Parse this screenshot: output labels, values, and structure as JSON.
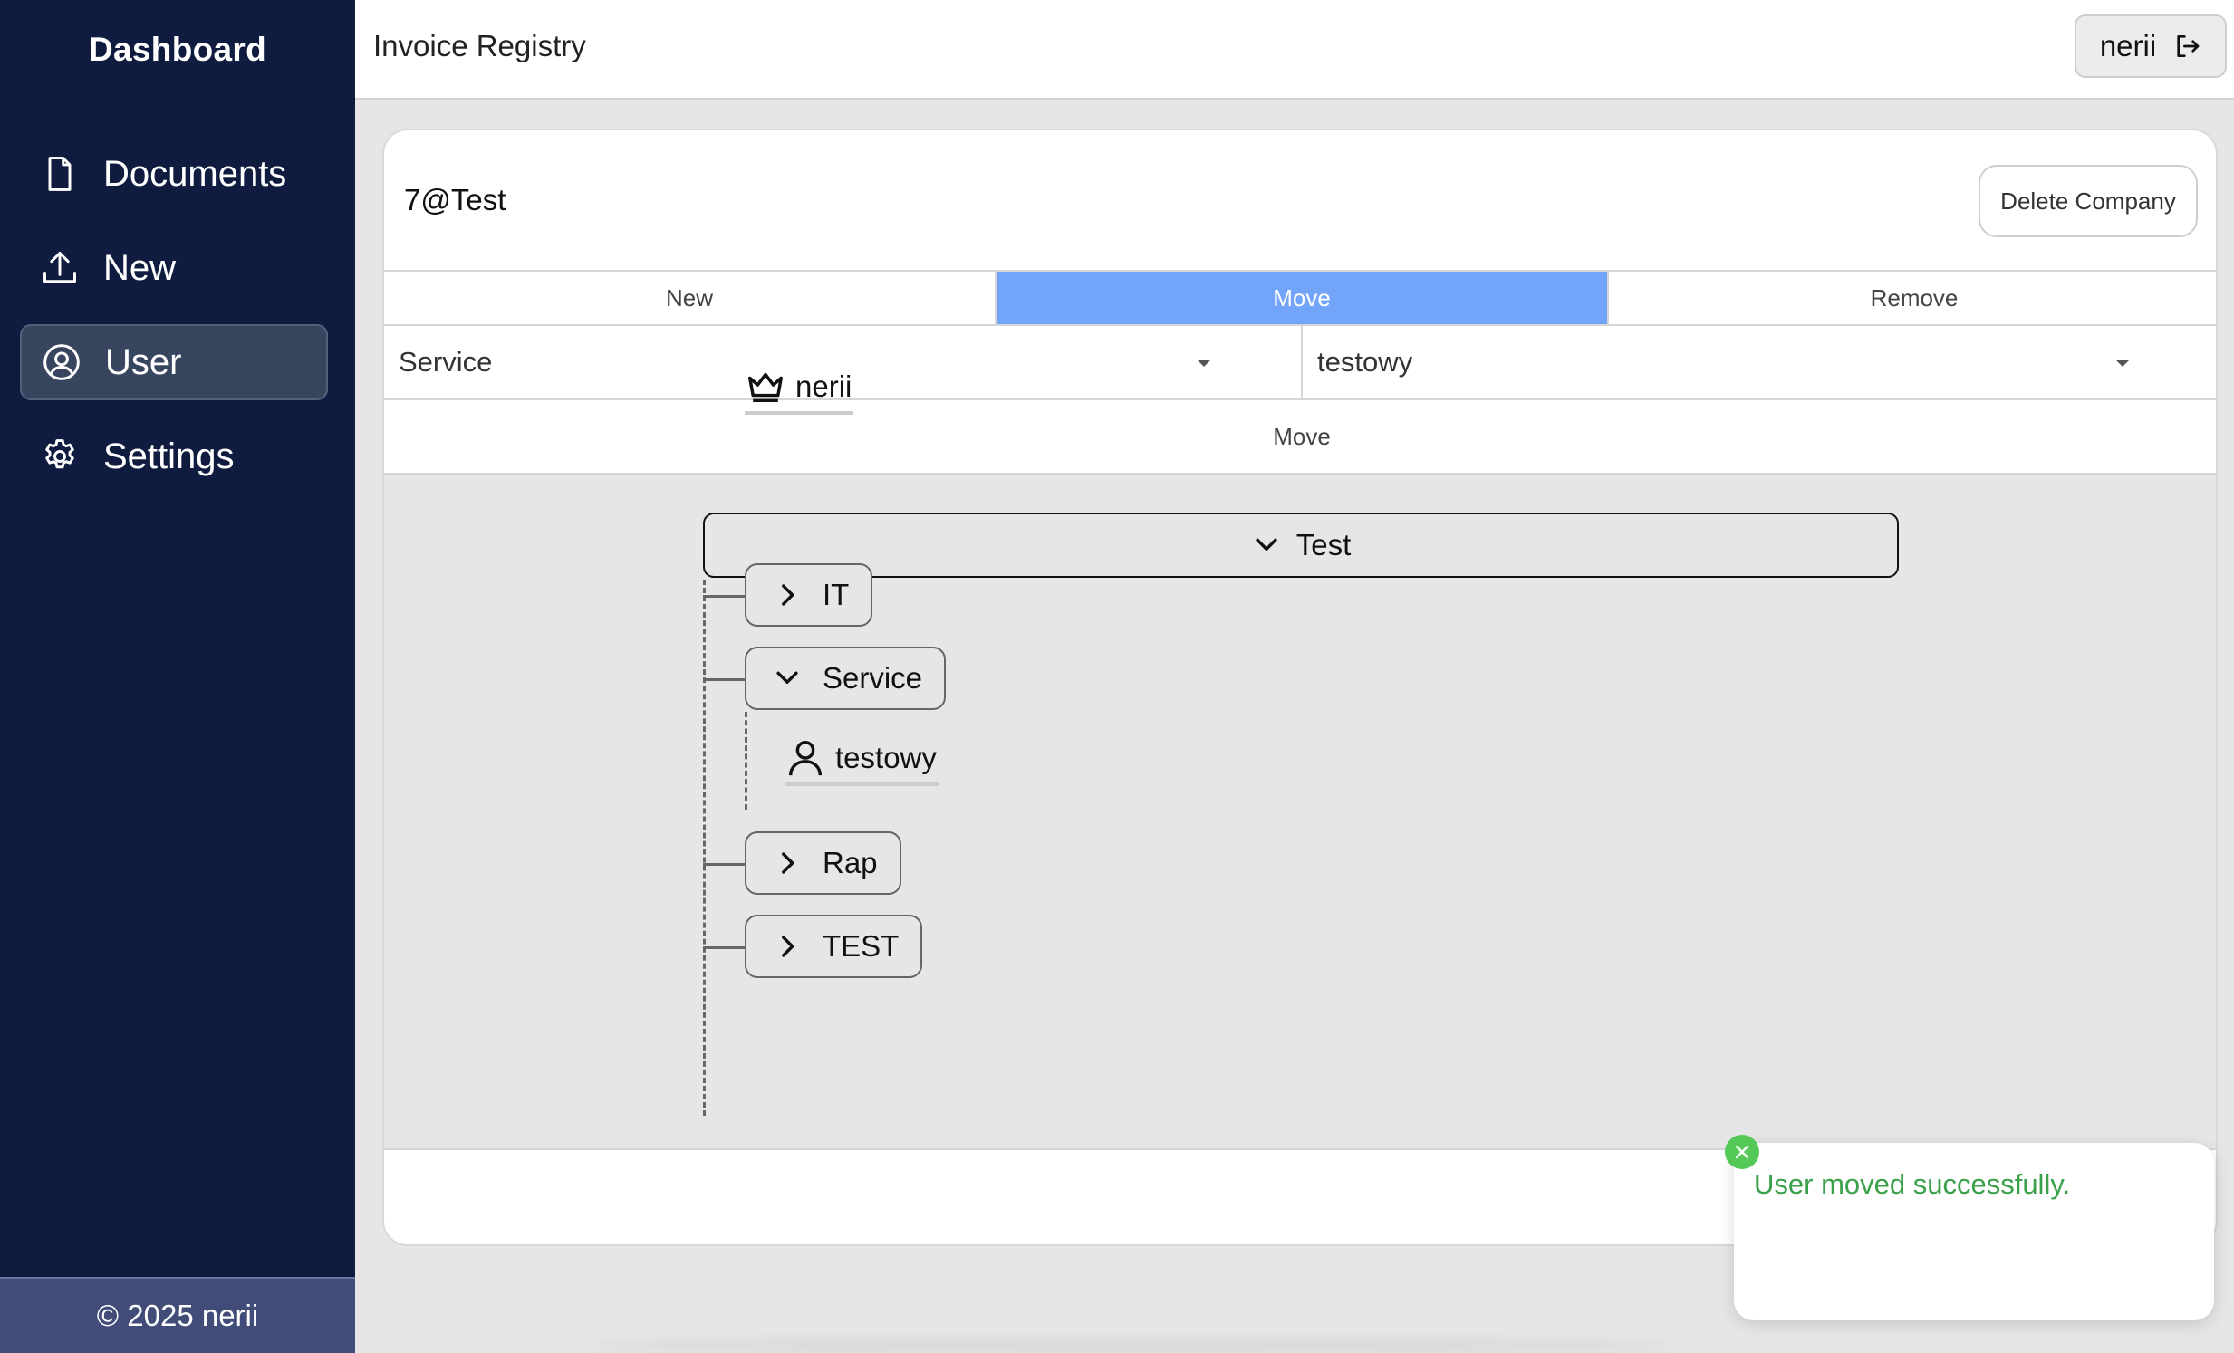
{
  "sidebar": {
    "brand": "Dashboard",
    "items": [
      {
        "label": "Documents",
        "icon": "document-icon"
      },
      {
        "label": "New",
        "icon": "upload-icon"
      },
      {
        "label": "User",
        "icon": "user-circle-icon",
        "active": true
      },
      {
        "label": "Settings",
        "icon": "gear-icon"
      }
    ],
    "footer": "© 2025 nerii"
  },
  "header": {
    "title": "Invoice Registry",
    "user": "nerii",
    "logout_icon": "logout-icon"
  },
  "company": {
    "name": "7@Test",
    "delete_label": "Delete Company"
  },
  "tabs": [
    {
      "label": "New"
    },
    {
      "label": "Move",
      "active": true
    },
    {
      "label": "Remove"
    }
  ],
  "move_form": {
    "group_select": "Service",
    "user_select": "testowy",
    "submit_label": "Move"
  },
  "tree": {
    "root": "Test",
    "owner": "nerii",
    "groups": [
      {
        "label": "IT",
        "expanded": false
      },
      {
        "label": "Service",
        "expanded": true,
        "members": [
          "testowy"
        ]
      },
      {
        "label": "Rap",
        "expanded": false
      },
      {
        "label": "TEST",
        "expanded": false
      }
    ]
  },
  "toast": {
    "message": "User moved successfully.",
    "color": "#3aa14a"
  },
  "colors": {
    "sidebar": "#0f1c3f",
    "active_tab": "#72a5fa",
    "footer": "#414c79"
  }
}
